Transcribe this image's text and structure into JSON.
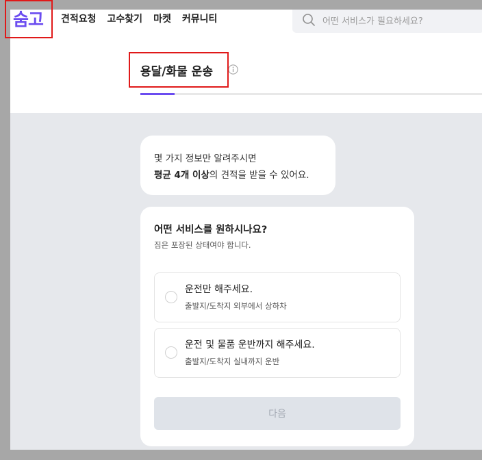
{
  "brand": {
    "logo": "숨고",
    "color": "#6b4cf0"
  },
  "nav": {
    "items": [
      "견적요청",
      "고수찾기",
      "마켓",
      "커뮤니티"
    ]
  },
  "search": {
    "placeholder": "어떤 서비스가 필요하세요?"
  },
  "page": {
    "title": "용달/화물 운송",
    "progress": 0.1
  },
  "intro": {
    "line1": "몇 가지 정보만 알려주시면",
    "line2_bold": "평균 4개 이상",
    "line2_rest": "의 견적을 받을 수 있어요."
  },
  "question": {
    "title": "어떤 서비스를 원하시나요?",
    "subtitle": "짐은 포장된 상태여야 합니다.",
    "options": [
      {
        "label": "운전만 해주세요.",
        "desc": "출발지/도착지 외부에서 상하차"
      },
      {
        "label": "운전 및 물품 운반까지 해주세요.",
        "desc": "출발지/도착지 실내까지 운반"
      }
    ]
  },
  "next_button": {
    "label": "다음"
  }
}
